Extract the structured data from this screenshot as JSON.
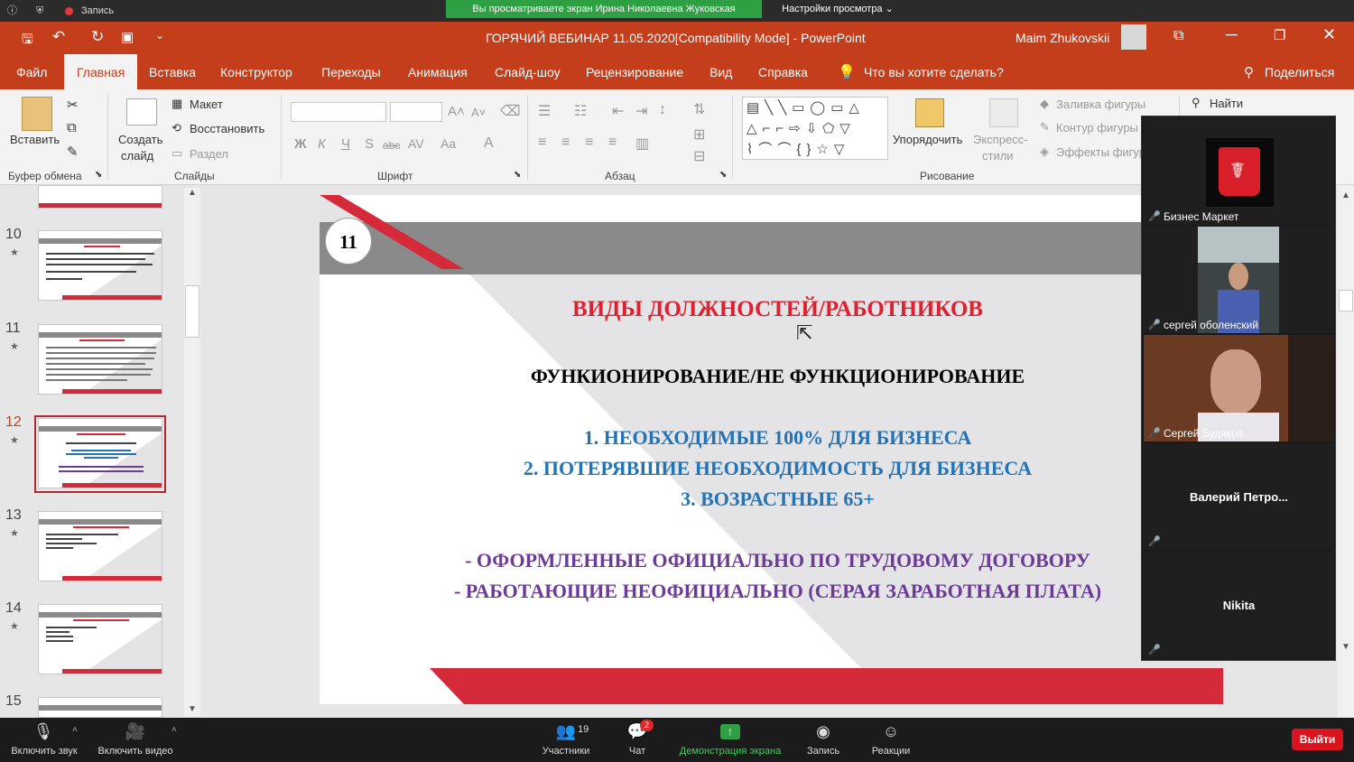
{
  "zoom": {
    "recording_label": "Запись",
    "share_banner": "Вы просматриваете экран Ирина Николаевна Жуковская",
    "view_options": "Настройки просмотра",
    "bottom": {
      "mute": "Включить звук",
      "video": "Включить видео",
      "participants": "Участники",
      "participants_count": "19",
      "chat": "Чат",
      "chat_badge": "2",
      "share": "Демонстрация экрана",
      "record": "Запись",
      "reactions": "Реакции",
      "leave": "Выйти"
    },
    "participants": [
      {
        "name": "Бизнес Маркет",
        "kind": "logo"
      },
      {
        "name": "сергей оболенский",
        "kind": "video"
      },
      {
        "name": "Сергей Будяков",
        "kind": "video"
      },
      {
        "name": "Валерий  Петро...",
        "kind": "name"
      },
      {
        "name": "Nikita",
        "kind": "name"
      }
    ],
    "colors": {
      "share_green": "#2ea043",
      "leave_red": "#d9141e"
    }
  },
  "ppt": {
    "title": "ГОРЯЧИЙ ВЕБИНАР 11.05.2020[Compatibility Mode]  -  PowerPoint",
    "user": "Maim Zhukovskii",
    "tabs": [
      "Файл",
      "Главная",
      "Вставка",
      "Конструктор",
      "Переходы",
      "Анимация",
      "Слайд-шоу",
      "Рецензирование",
      "Вид",
      "Справка"
    ],
    "active_tab": "Главная",
    "tell_me": "Что вы хотите сделать?",
    "share": "Поделиться",
    "ribbon": {
      "paste": "Вставить",
      "new_slide_1": "Создать",
      "new_slide_2": "слайд",
      "layout": "Макет",
      "reset": "Восстановить",
      "section": "Раздел",
      "arrange": "Упорядочить",
      "quick_styles_1": "Экспресс-",
      "quick_styles_2": "стили",
      "shape_fill": "Заливка фигуры",
      "shape_outline": "Контур фигуры",
      "shape_effects": "Эффекты фигур",
      "find": "Найти",
      "font_bold": "Ж",
      "font_italic": "К",
      "font_underline": "Ч",
      "font_s": "S",
      "font_abc": "abc",
      "font_av": "AV",
      "font_aa": "Aa",
      "font_a": "A",
      "groups": {
        "clipboard": "Буфер обмена",
        "slides": "Слайды",
        "font": "Шрифт",
        "paragraph": "Абзац",
        "drawing": "Рисование"
      }
    },
    "thumbnails": [
      {
        "num": "10"
      },
      {
        "num": "11"
      },
      {
        "num": "12",
        "selected": true
      },
      {
        "num": "13"
      },
      {
        "num": "14"
      },
      {
        "num": "15"
      }
    ],
    "slide": {
      "number": "11",
      "title": "ВИДЫ  ДОЛЖНОСТЕЙ/РАБОТНИКОВ",
      "subtitle": "ФУНКИОНИРОВАНИЕ/НЕ ФУНКЦИОНИРОВАНИЕ",
      "list": [
        "1. НЕОБХОДИМЫЕ 100% ДЛЯ БИЗНЕСА",
        "2. ПОТЕРЯВШИЕ НЕОБХОДИМОСТЬ ДЛЯ БИЗНЕСА",
        "3. ВОЗРАСТНЫЕ 65+"
      ],
      "dash_items": [
        "-  ОФОРМЛЕННЫЕ ОФИЦИАЛЬНО ПО ТРУДОВОМУ ДОГОВОРУ",
        "- РАБОТАЮЩИЕ НЕОФИЦИАЛЬНО (СЕРАЯ ЗАРАБОТНАЯ ПЛАТА)"
      ],
      "colors": {
        "title": "#e0202f",
        "list": "#2473b4",
        "dash": "#6c3a97",
        "accent_red": "#d42a3a",
        "bar_gray": "#8a8a8a"
      }
    }
  }
}
